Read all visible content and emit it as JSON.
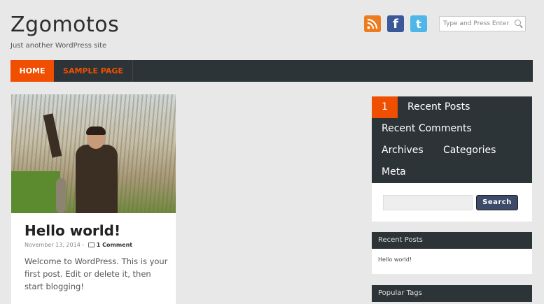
{
  "header": {
    "site_title": "Zgomotos",
    "tagline": "Just another WordPress site",
    "search_placeholder": "Type and Press Enter"
  },
  "social": {
    "rss_icon": "rss-icon",
    "facebook_label": "f",
    "twitter_label": "t"
  },
  "nav": {
    "items": [
      {
        "label": "HOME"
      },
      {
        "label": "SAMPLE PAGE"
      }
    ]
  },
  "post": {
    "title": "Hello world!",
    "date": "November 13, 2014",
    "separator": "-",
    "comments": "1 Comment",
    "excerpt": "Welcome to WordPress. This is your first post. Edit or delete it, then start blogging!"
  },
  "sidebar": {
    "tabs": {
      "number": "1",
      "recent_posts": "Recent Posts",
      "recent_comments": "Recent Comments",
      "archives": "Archives",
      "categories": "Categories",
      "meta": "Meta"
    },
    "search_button": "Search",
    "recent_posts_title": "Recent Posts",
    "recent_posts_items": [
      "Hello world!"
    ],
    "popular_tags_title": "Popular Tags"
  },
  "colors": {
    "accent": "#f04e00",
    "nav_bg": "#2d3438",
    "button": "#3d4a68"
  }
}
